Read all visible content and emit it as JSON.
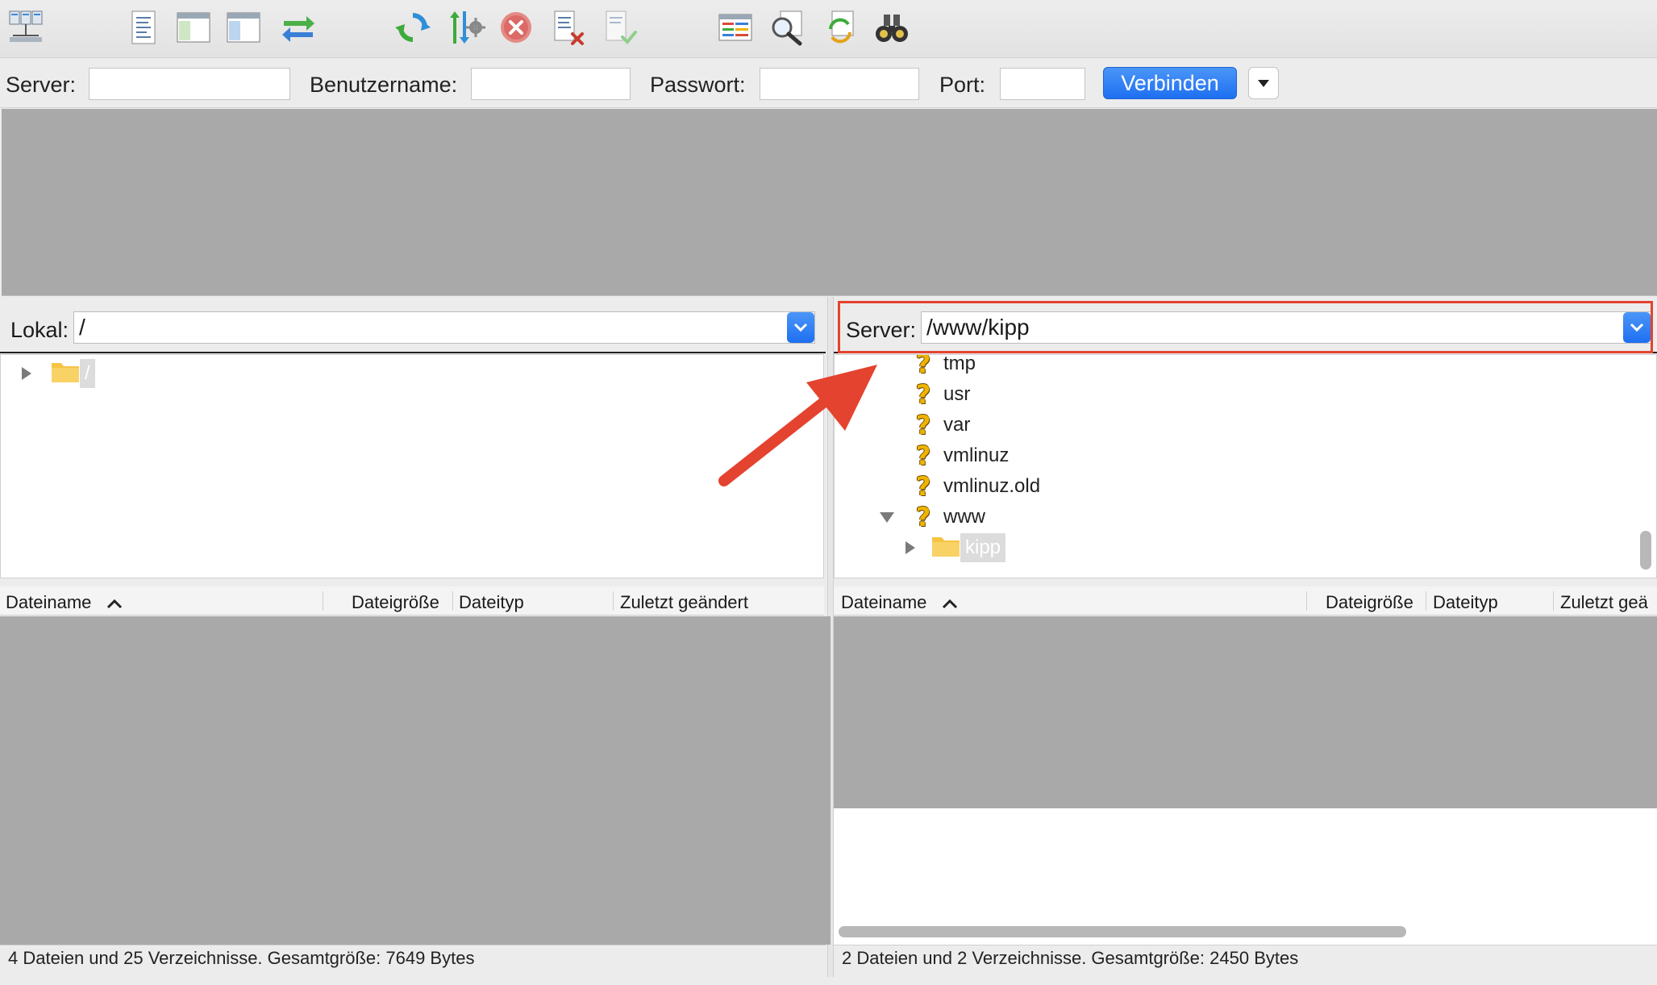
{
  "quickconnect": {
    "server_label": "Server:",
    "user_label": "Benutzername:",
    "pass_label": "Passwort:",
    "port_label": "Port:",
    "server_value": "",
    "user_value": "",
    "pass_value": "",
    "port_value": "",
    "connect_label": "Verbinden"
  },
  "local": {
    "label": "Lokal:",
    "path": "/",
    "tree": [
      {
        "name": "/",
        "expanded": false,
        "selected": true
      }
    ],
    "columns": [
      "Dateiname",
      "Dateigröße",
      "Dateityp",
      "Zuletzt geändert"
    ],
    "status": "4 Dateien und 25 Verzeichnisse. Gesamtgröße: 7649 Bytes"
  },
  "remote": {
    "label": "Server:",
    "path": "/www/kipp",
    "tree": [
      {
        "name": "tmp",
        "icon": "unknown-icon"
      },
      {
        "name": "usr",
        "icon": "unknown-icon"
      },
      {
        "name": "var",
        "icon": "unknown-icon"
      },
      {
        "name": "vmlinuz",
        "icon": "unknown-icon"
      },
      {
        "name": "vmlinuz.old",
        "icon": "unknown-icon"
      },
      {
        "name": "www",
        "icon": "unknown-icon",
        "expanded": true
      },
      {
        "name": "kipp",
        "icon": "folder-icon",
        "selected": true
      }
    ],
    "columns": [
      "Dateiname",
      "Dateigröße",
      "Dateityp",
      "Zuletzt geä"
    ],
    "status": "2 Dateien und 2 Verzeichnisse. Gesamtgröße: 2450 Bytes"
  },
  "colors": {
    "accent": "#1e6ff1",
    "highlight": "#e4432f",
    "folder": "#f6c444"
  }
}
